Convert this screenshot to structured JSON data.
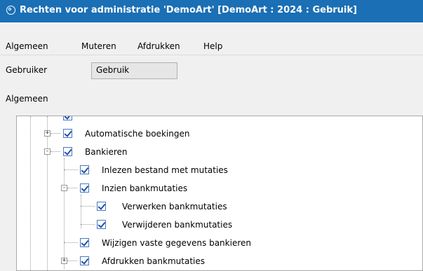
{
  "window": {
    "title": "Rechten voor administratie 'DemoArt'  [DemoArt : 2024 : Gebruik]"
  },
  "menu": [
    "Algemeen",
    "Muteren",
    "Afdrukken",
    "Help"
  ],
  "form": {
    "user_label": "Gebruiker",
    "user_value": "Gebruik",
    "section_label": "Algemeen"
  },
  "tree": {
    "nodes": [
      {
        "label": "Automatische boekingen",
        "checked": true,
        "expander": "+"
      },
      {
        "label": "Bankieren",
        "checked": true,
        "expander": "-"
      },
      {
        "label": "Inlezen bestand met mutaties",
        "checked": true
      },
      {
        "label": "Inzien bankmutaties",
        "checked": true,
        "expander": "-"
      },
      {
        "label": "Verwerken bankmutaties",
        "checked": true
      },
      {
        "label": "Verwijderen bankmutaties",
        "checked": true
      },
      {
        "label": "Wijzigen vaste gegevens bankieren",
        "checked": true
      },
      {
        "label": "Afdrukken bankmutaties",
        "checked": true,
        "expander": "+"
      }
    ]
  }
}
